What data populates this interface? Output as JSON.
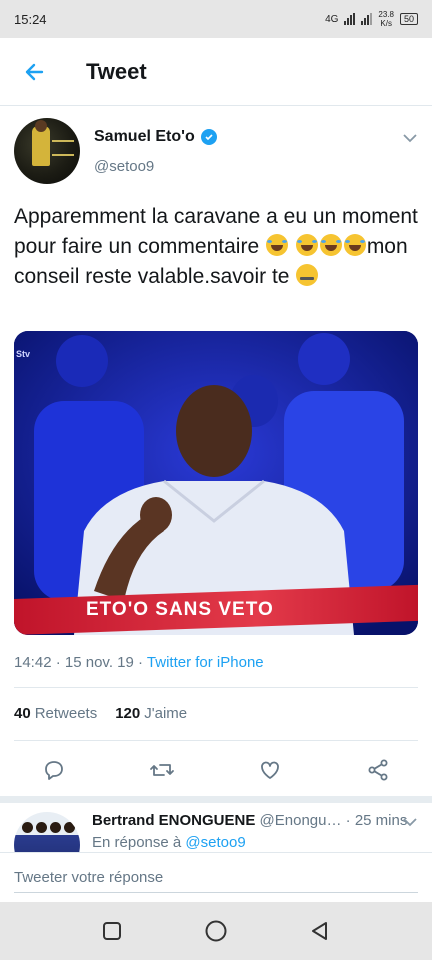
{
  "status_bar": {
    "time": "15:24",
    "network": "4G",
    "speed_value": "23.8",
    "speed_unit": "K/s",
    "battery": "50"
  },
  "header": {
    "title": "Tweet"
  },
  "tweet": {
    "author_name": "Samuel Eto'o",
    "author_handle": "@setoo9",
    "text_part1": "Apparemment la caravane a eu un moment pour faire un commentaire ",
    "text_part2": "mon conseil reste valable.savoir te ",
    "media_caption": "ETO'O SANS VETO",
    "media_logo": "Stv",
    "time": "14:42",
    "date": "15 nov. 19",
    "source": "Twitter for iPhone",
    "retweets_count": "40",
    "retweets_label": "Retweets",
    "likes_count": "120",
    "likes_label": "J'aime"
  },
  "reply": {
    "name": "Bertrand ENONGUENE",
    "handle": "@Enongu…",
    "age": "25 mins",
    "in_reply_to_label": "En réponse à",
    "in_reply_to_handle": "@setoo9"
  },
  "compose": {
    "placeholder": "Tweeter votre réponse"
  },
  "colors": {
    "accent": "#1da1f2",
    "caption_red": "#d61f35",
    "muted": "#657786"
  }
}
